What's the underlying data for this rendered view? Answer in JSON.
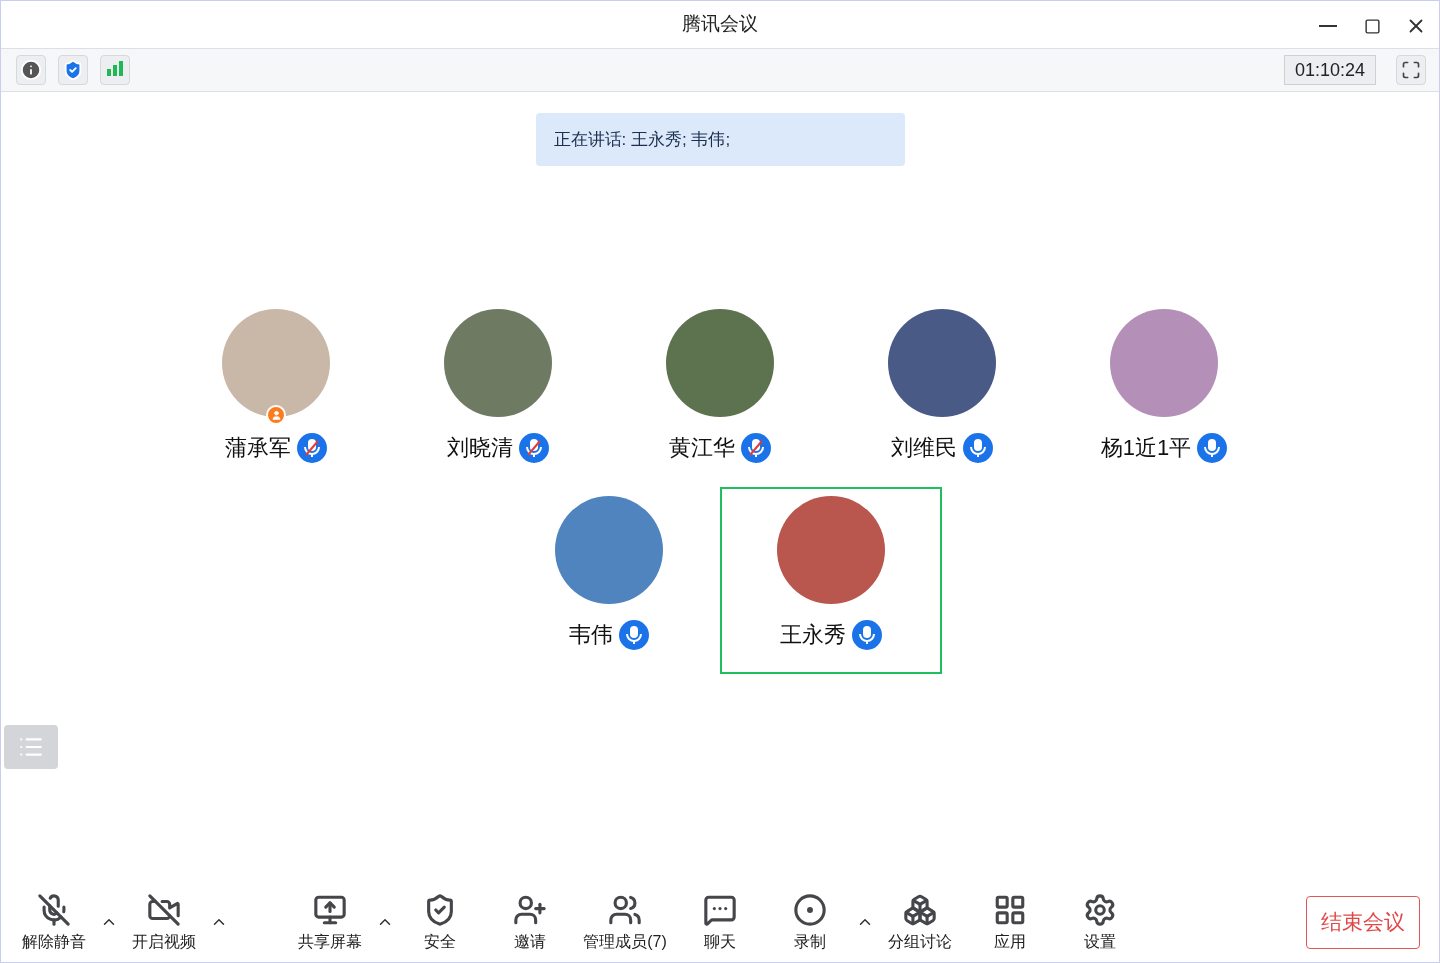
{
  "window": {
    "title": "腾讯会议"
  },
  "info_bar": {
    "timer": "01:10:24"
  },
  "speaking_banner": "正在讲话: 王永秀; 韦伟;",
  "participants": [
    {
      "name": "蒲承军",
      "muted": true,
      "host": true,
      "selected": false,
      "color": "#c9b7a8"
    },
    {
      "name": "刘晓清",
      "muted": true,
      "host": false,
      "selected": false,
      "color": "#6f7a63"
    },
    {
      "name": "黄江华",
      "muted": true,
      "host": false,
      "selected": false,
      "color": "#5d7350"
    },
    {
      "name": "刘维民",
      "muted": false,
      "host": false,
      "selected": false,
      "color": "#4a5a86"
    },
    {
      "name": "杨1近1平",
      "muted": false,
      "host": false,
      "selected": false,
      "color": "#b48fb8"
    },
    {
      "name": "韦伟",
      "muted": false,
      "host": false,
      "selected": false,
      "color": "#4f84bf"
    },
    {
      "name": "王永秀",
      "muted": false,
      "host": false,
      "selected": true,
      "color": "#b9564d"
    }
  ],
  "toolbar": {
    "groups": [
      [
        {
          "label": "解除静音",
          "has_menu": true
        },
        {
          "label": "开启视频",
          "has_menu": true
        }
      ],
      [
        {
          "label": "共享屏幕",
          "has_menu": true
        },
        {
          "label": "安全",
          "has_menu": false
        },
        {
          "label": "邀请",
          "has_menu": false
        },
        {
          "label": "管理成员(7)",
          "has_menu": false
        },
        {
          "label": "聊天",
          "has_menu": false
        },
        {
          "label": "录制",
          "has_menu": true
        },
        {
          "label": "分组讨论",
          "has_menu": false
        },
        {
          "label": "应用",
          "has_menu": false
        },
        {
          "label": "设置",
          "has_menu": false
        }
      ]
    ],
    "end_button": "结束会议"
  }
}
